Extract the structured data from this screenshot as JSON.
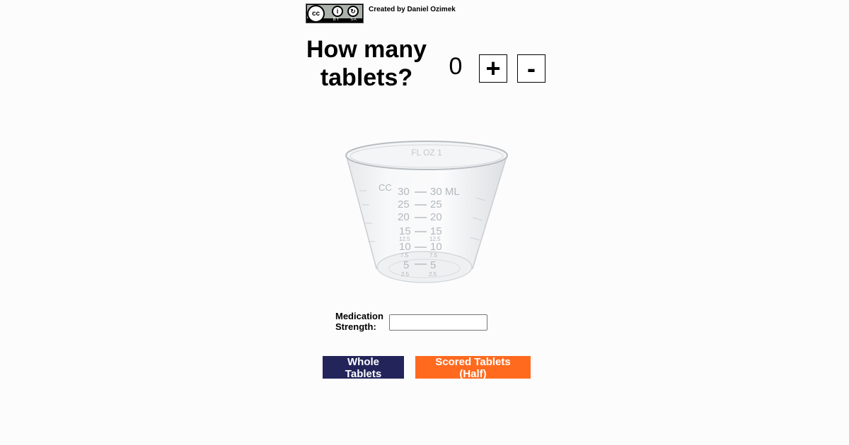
{
  "license": {
    "cc_text": "cc",
    "by_text": "BY",
    "sa_text": "SA"
  },
  "credit": "Created by Daniel Ozimek",
  "title": "How many tablets?",
  "counter": {
    "value": "0",
    "plus_label": "+",
    "minus_label": "-"
  },
  "cup": {
    "top_marks": "FL OZ 1",
    "left_scale": [
      "CC",
      "30",
      "25",
      "20",
      "15",
      "12.5",
      "10",
      "7.5",
      "5",
      "2.5"
    ],
    "right_scale": [
      "30 ML",
      "25",
      "20",
      "15",
      "12.5",
      "10",
      "7.5",
      "5",
      "2.5"
    ]
  },
  "form": {
    "strength_label": "Medication Strength:",
    "strength_value": ""
  },
  "buttons": {
    "whole_label": "Whole Tablets",
    "scored_label": "Scored Tablets (Half)"
  },
  "colors": {
    "whole_bg": "#22245a",
    "scored_bg": "#ff6a1f",
    "background": "#fcfcfc"
  }
}
